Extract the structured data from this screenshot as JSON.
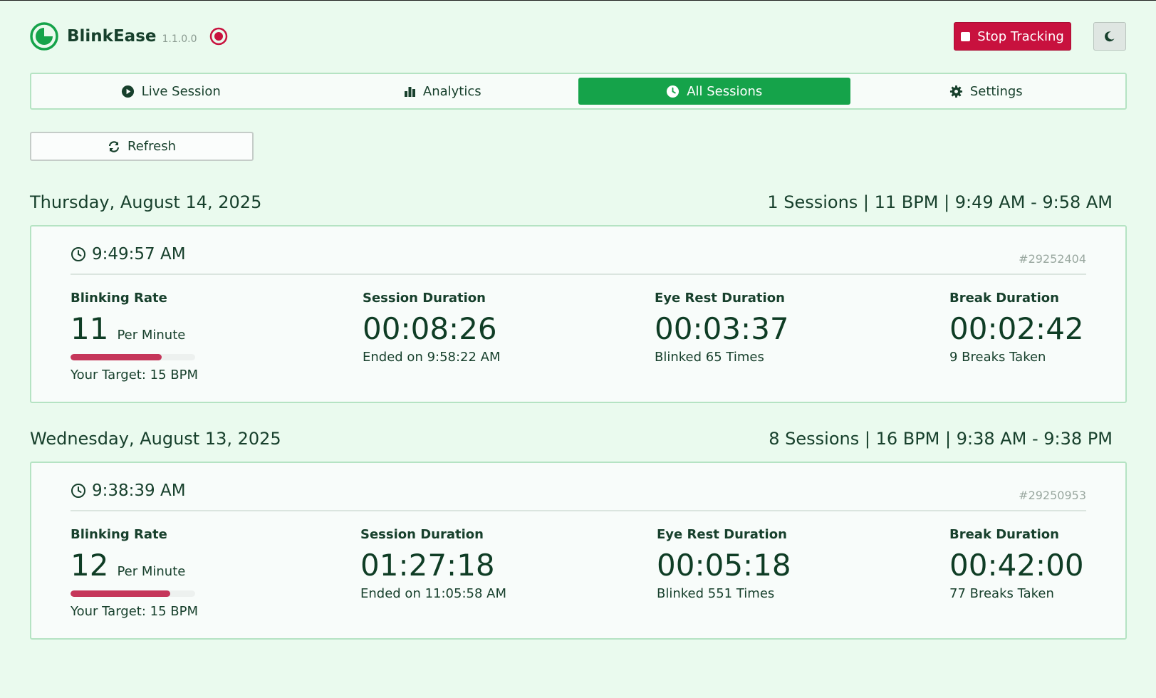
{
  "app": {
    "name": "BlinkEase",
    "version": "1.1.0.0"
  },
  "header": {
    "stop_label": "Stop Tracking"
  },
  "tabs": [
    {
      "label": "Live Session",
      "icon": "play-circle-icon"
    },
    {
      "label": "Analytics",
      "icon": "bar-chart-icon"
    },
    {
      "label": "All Sessions",
      "icon": "clock-icon",
      "active": true
    },
    {
      "label": "Settings",
      "icon": "gear-icon"
    }
  ],
  "refresh_label": "Refresh",
  "labels": {
    "blinking_rate": "Blinking Rate",
    "per_minute": "Per Minute",
    "session_duration": "Session Duration",
    "eye_rest_duration": "Eye Rest Duration",
    "break_duration": "Break Duration"
  },
  "colors": {
    "accent": "#15a34a",
    "danger": "#c8113e",
    "rate_bar": "#c5365a",
    "background": "#eafaee"
  },
  "days": [
    {
      "title": "Thursday, August 14, 2025",
      "summary": "1 Sessions | 11 BPM | 9:49 AM - 9:58 AM",
      "session": {
        "start_time": "9:49:57 AM",
        "id": "#29252404",
        "rate": "11",
        "rate_fraction": 0.73,
        "target": "Your Target: 15 BPM",
        "session_duration": "00:08:26",
        "ended": "Ended on 9:58:22 AM",
        "eye_rest_duration": "00:03:37",
        "blinked": "Blinked 65 Times",
        "break_duration": "00:02:42",
        "breaks": "9 Breaks Taken"
      }
    },
    {
      "title": "Wednesday, August 13, 2025",
      "summary": "8 Sessions | 16 BPM | 9:38 AM - 9:38 PM",
      "session": {
        "start_time": "9:38:39 AM",
        "id": "#29250953",
        "rate": "12",
        "rate_fraction": 0.8,
        "target": "Your Target: 15 BPM",
        "session_duration": "01:27:18",
        "ended": "Ended on 11:05:58 AM",
        "eye_rest_duration": "00:05:18",
        "blinked": "Blinked 551 Times",
        "break_duration": "00:42:00",
        "breaks": "77 Breaks Taken"
      }
    }
  ]
}
